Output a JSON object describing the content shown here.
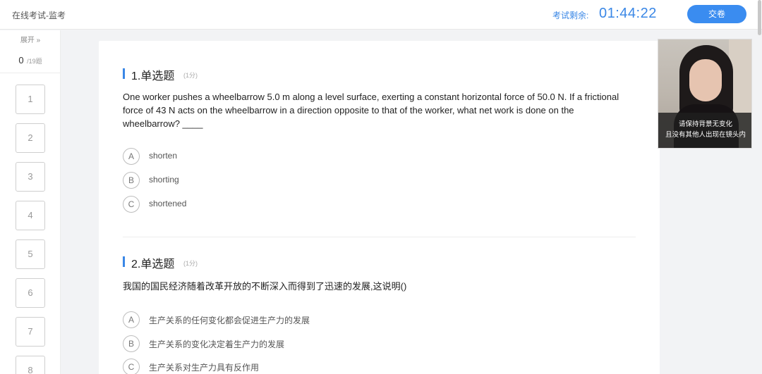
{
  "header": {
    "app_title": "在线考试-监考",
    "timer_label": "考试剩余:",
    "timer_value": "01:44:22",
    "submit_label": "交卷"
  },
  "sidebar": {
    "expand_label": "展开 »",
    "answered": "0",
    "total": "/19题",
    "question_numbers": [
      "1",
      "2",
      "3",
      "4",
      "5",
      "6",
      "7",
      "8"
    ]
  },
  "questions": [
    {
      "title": "1.单选题",
      "score": "(1分)",
      "stem": "One worker pushes a wheelbarrow 5.0 m along a level surface, exerting a constant horizontal force of 50.0 N. If a frictional force of 43 N acts on the wheelbarrow in a direction opposite to that of the worker, what net work is done on the wheelbarrow? ____",
      "options": [
        {
          "letter": "A",
          "text": "shorten"
        },
        {
          "letter": "B",
          "text": "shorting"
        },
        {
          "letter": "C",
          "text": "shortened"
        }
      ]
    },
    {
      "title": "2.单选题",
      "score": "(1分)",
      "stem": "我国的国民经济随着改革开放的不断深入而得到了迅速的发展,这说明()",
      "options": [
        {
          "letter": "A",
          "text": "生产关系的任何变化都会促进生产力的发展"
        },
        {
          "letter": "B",
          "text": "生产关系的变化决定着生产力的发展"
        },
        {
          "letter": "C",
          "text": "生产关系对生产力具有反作用"
        }
      ]
    }
  ],
  "camera": {
    "notice_line1": "请保持背景无变化",
    "notice_line2": "且没有其他人出现在镜头内"
  },
  "colors": {
    "accent": "#3a87e6",
    "button": "#3a8cf0",
    "page_background": "#f2f3f5"
  }
}
